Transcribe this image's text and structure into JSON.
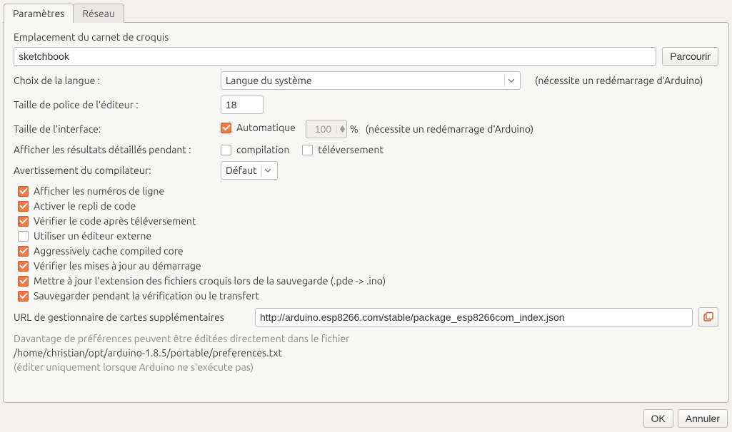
{
  "tabs": {
    "settings": "Paramètres",
    "network": "Réseau"
  },
  "sketchbook": {
    "label": "Emplacement du carnet de croquis",
    "value": "sketchbook",
    "browse": "Parcourir"
  },
  "language": {
    "label": "Choix de la langue :",
    "value": "Langue du système",
    "note": "(nécessite un redémarrage d'Arduino)"
  },
  "fontsize": {
    "label": "Taille de police de l'éditeur :",
    "value": "18"
  },
  "uiscale": {
    "label": "Taille de l'interface:",
    "auto": "Automatique",
    "value": "100",
    "percent": "%",
    "note": "(nécessite un redémarrage d'Arduino)"
  },
  "verbose": {
    "label": "Afficher les résultats détaillés pendant :",
    "compile": "compilation",
    "upload": "téléversement"
  },
  "warnings": {
    "label": "Avertissement du compilateur:",
    "value": "Défaut"
  },
  "checks": {
    "line_numbers": "Afficher les numéros de ligne",
    "code_folding": "Activer le repli de code",
    "verify_after": "Vérifier le code après téléversement",
    "external_editor": "Utiliser un éditeur externe",
    "cache_core": "Aggressively cache compiled core",
    "check_updates": "Vérifier les mises à jour au démarrage",
    "update_ext": "Mettre à jour  l'extension des fichiers croquis lors de la sauvegarde (.pde -> .ino)",
    "save_on_verify": "Sauvegarder pendant la vérification ou le transfert"
  },
  "boards_url": {
    "label": "URL de gestionnaire de cartes supplémentaires",
    "value": "http://arduino.esp8266.com/stable/package_esp8266com_index.json"
  },
  "more_prefs": {
    "line1": "Davantage de préférences peuvent être éditées directement dans le fichier",
    "path": "/home/christian/opt/arduino-1.8.5/portable/preferences.txt",
    "line2": "(éditer uniquement lorsque Arduino ne s'exécute pas)"
  },
  "buttons": {
    "ok": "OK",
    "cancel": "Annuler"
  }
}
